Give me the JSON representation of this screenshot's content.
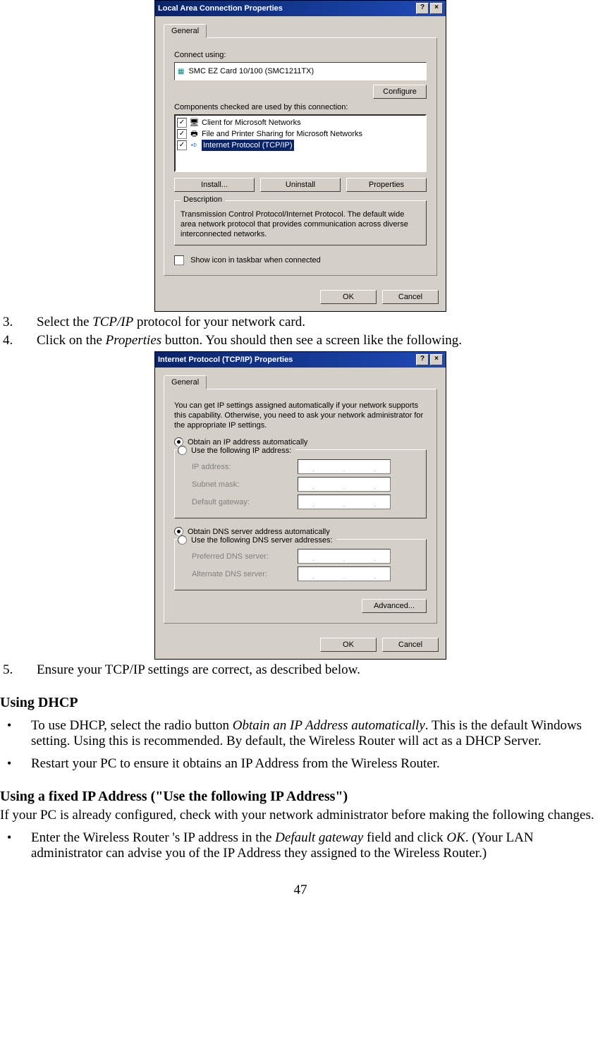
{
  "dlg1": {
    "title": "Local Area Connection Properties",
    "tab": "General",
    "connect_label": "Connect using:",
    "adapter": "SMC EZ Card 10/100 (SMC1211TX)",
    "configure": "Configure",
    "components_label": "Components checked are used by this connection:",
    "items": [
      "Client for Microsoft Networks",
      "File and Printer Sharing for Microsoft Networks",
      "Internet Protocol (TCP/IP)"
    ],
    "install": "Install...",
    "uninstall": "Uninstall",
    "properties": "Properties",
    "desc_title": "Description",
    "desc": "Transmission Control Protocol/Internet Protocol. The default wide area network protocol that provides communication across diverse interconnected networks.",
    "showicon": "Show icon in taskbar when connected",
    "ok": "OK",
    "cancel": "Cancel"
  },
  "doc": {
    "step3": "Select the TCP/IP protocol for your network card.",
    "step4": "Click on the Properties button. You should then see a screen like the following.",
    "step5": "Ensure your TCP/IP settings are correct, as described below.",
    "h1": "Using DHCP",
    "b1": "To use DHCP, select the radio button Obtain an IP Address automatically. This is the default Windows setting. Using this is recommended. By default, the Wireless  Router will act as a DHCP Server.",
    "b2": "Restart your PC to ensure it obtains an IP Address from the Wireless  Router.",
    "h2": "Using a fixed IP Address (\"Use the following IP Address\")",
    "p1": "If your PC is already configured, check with your network administrator before making the following changes.",
    "b3": "Enter the Wireless  Router 's IP address in the Default gateway field and click OK. (Your LAN administrator can advise you of the IP Address they assigned to the Wireless  Router.)",
    "pagenum": "47"
  },
  "dlg2": {
    "title": "Internet Protocol (TCP/IP) Properties",
    "tab": "General",
    "intro": "You can get IP settings assigned automatically if your network supports this capability. Otherwise, you need to ask your network administrator for the appropriate IP settings.",
    "r1": "Obtain an IP address automatically",
    "r2": "Use the following IP address:",
    "ip": "IP address:",
    "mask": "Subnet mask:",
    "gw": "Default gateway:",
    "r3": "Obtain DNS server address automatically",
    "r4": "Use the following DNS server addresses:",
    "pdns": "Preferred DNS server:",
    "adns": "Alternate DNS server:",
    "adv": "Advanced...",
    "ok": "OK",
    "cancel": "Cancel"
  }
}
